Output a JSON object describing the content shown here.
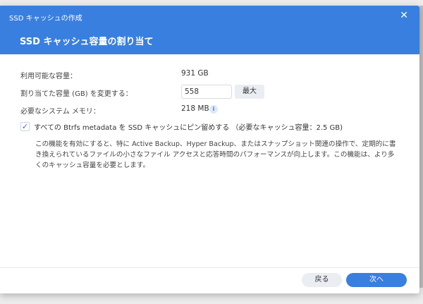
{
  "window": {
    "title": "SSD キャッシュの作成",
    "close_icon": "close-icon"
  },
  "header": {
    "title": "SSD キャッシュ容量の割り当て"
  },
  "form": {
    "available_label": "利用可能な容量：",
    "available_value": "931 GB",
    "allocate_label": "割り当てた容量 (GB) を変更する：",
    "allocate_value": "558",
    "max_button": "最大",
    "memory_label": "必要なシステム メモリ：",
    "memory_value": "218 MB",
    "info_icon": "i",
    "pin_checked": true,
    "pin_label": "すべての Btrfs metadata を SSD キャッシュにピン留めする （必要なキャッシュ容量：2.5 GB)",
    "description": "この機能を有効にすると、特に Active Backup、Hyper Backup、またはスナップショット関連の操作で、定期的に書き換えられているファイルの小さなファイル アクセスと応答時間のパフォーマンスが向上します。この機能は、より多くのキャッシュ容量を必要とします。"
  },
  "footer": {
    "back": "戻る",
    "next": "次へ"
  },
  "colors": {
    "accent": "#397fe0"
  }
}
